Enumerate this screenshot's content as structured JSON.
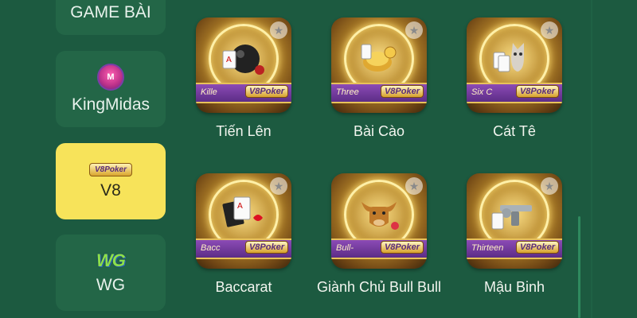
{
  "sidebar": {
    "items": [
      {
        "label": "GAME BÀI",
        "icon": "none",
        "active": false
      },
      {
        "label": "KingMidas",
        "icon": "kingmidas-logo-icon",
        "icon_text": "M",
        "active": false
      },
      {
        "label": "V8",
        "icon": "v8poker-logo-icon",
        "icon_text": "V8Poker",
        "active": true
      },
      {
        "label": "WG",
        "icon": "wg-logo-icon",
        "icon_text": "WG",
        "active": false
      }
    ]
  },
  "games": [
    {
      "name": "Tiến Lên",
      "banner": "Kille",
      "badge": "V8Poker",
      "art": "bomb-cards-art"
    },
    {
      "name": "Bài Cào",
      "banner": "Three",
      "badge": "V8Poker",
      "art": "gold-coins-art"
    },
    {
      "name": "Cát Tê",
      "banner": "Six C",
      "badge": "V8Poker",
      "art": "cat-cards-art"
    },
    {
      "name": "Baccarat",
      "banner": "Bacc",
      "badge": "V8Poker",
      "art": "playing-cards-art"
    },
    {
      "name": "Giành Chủ Bull Bull",
      "banner": "Bull-",
      "badge": "V8Poker",
      "art": "bull-head-art"
    },
    {
      "name": "Mậu Binh",
      "banner": "Thirteen",
      "badge": "V8Poker",
      "art": "pistol-cards-art"
    }
  ],
  "colors": {
    "background": "#1c5a40",
    "tile": "#236647",
    "active_tile": "#f7e35a",
    "banner_purple": "#6b3596",
    "gold": "#e8c25a"
  }
}
